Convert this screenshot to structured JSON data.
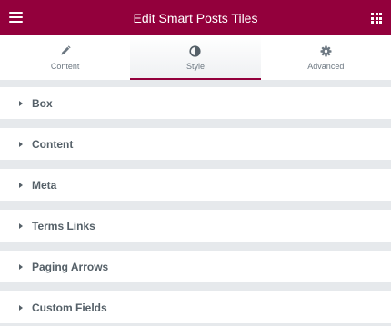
{
  "header": {
    "title": "Edit Smart Posts Tiles"
  },
  "tabs": [
    {
      "label": "Content",
      "icon": "pencil-icon"
    },
    {
      "label": "Style",
      "icon": "half-circle-icon"
    },
    {
      "label": "Advanced",
      "icon": "gear-icon"
    }
  ],
  "active_tab": "Style",
  "sections": [
    {
      "label": "Box"
    },
    {
      "label": "Content"
    },
    {
      "label": "Meta"
    },
    {
      "label": "Terms Links"
    },
    {
      "label": "Paging Arrows"
    },
    {
      "label": "Custom Fields"
    }
  ],
  "colors": {
    "brand": "#93003c",
    "text": "#556068",
    "muted": "#6d7882",
    "background": "#e6e9ec"
  }
}
